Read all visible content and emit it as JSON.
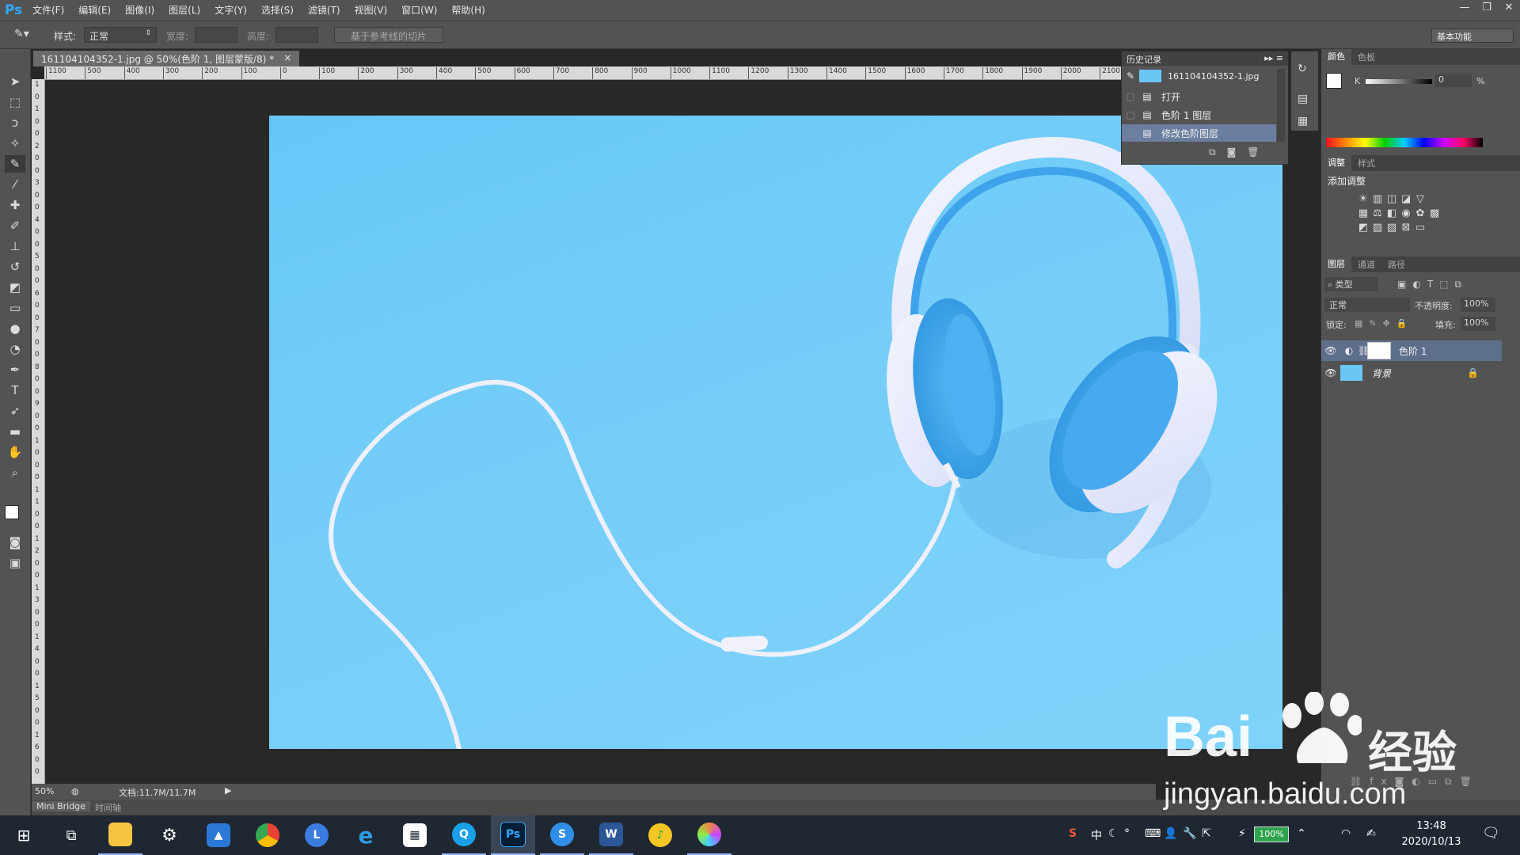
{
  "menubar": {
    "logo": "Ps",
    "items": [
      "文件(F)",
      "编辑(E)",
      "图像(I)",
      "图层(L)",
      "文字(Y)",
      "选择(S)",
      "滤镜(T)",
      "视图(V)",
      "窗口(W)",
      "帮助(H)"
    ],
    "window_controls": [
      "—",
      "❐",
      "✕"
    ]
  },
  "options": {
    "style_label": "样式:",
    "style_value": "正常",
    "width_label": "宽度:",
    "height_label": "高度:",
    "slice_button": "基于参考线的切片",
    "workspace": "基本功能"
  },
  "document": {
    "tab_title": "161104104352-1.jpg @ 50%(色阶 1, 图层蒙版/8) *",
    "close": "×",
    "ruler_top": [
      "1100",
      "500",
      "400",
      "300",
      "200",
      "100",
      "0",
      "100",
      "200",
      "300",
      "400",
      "500",
      "600",
      "700",
      "800",
      "900",
      "1000",
      "1100",
      "1200",
      "1300",
      "1400",
      "1500",
      "1600",
      "1700",
      "1800",
      "1900",
      "2000",
      "2100"
    ],
    "ruler_left": [
      "1",
      "0",
      "1",
      "0",
      "0",
      "2",
      "0",
      "0",
      "3",
      "0",
      "0",
      "4",
      "0",
      "0",
      "5",
      "0",
      "0",
      "6",
      "0",
      "0",
      "7",
      "0",
      "0",
      "8",
      "0",
      "0",
      "9",
      "0",
      "0",
      "1",
      "0",
      "0",
      "0",
      "1",
      "1",
      "0",
      "0",
      "1",
      "2",
      "0",
      "0",
      "1",
      "3",
      "0",
      "0",
      "1",
      "4",
      "0",
      "0",
      "1",
      "5",
      "0",
      "0",
      "1",
      "6",
      "0",
      "0"
    ]
  },
  "status": {
    "zoom": "50%",
    "doc_info": "文档:11.7M/11.7M",
    "tabs": [
      "Mini Bridge",
      "时间轴"
    ]
  },
  "history": {
    "title": "历史记录",
    "snapshot": "161104104352-1.jpg",
    "items": [
      "打开",
      "色阶 1 图层",
      "修改色阶图层"
    ]
  },
  "color_panel": {
    "tabs": [
      "颜色",
      "色板"
    ],
    "channel": "K",
    "value": "0",
    "unit": "%"
  },
  "adjustments": {
    "tabs": [
      "调整",
      "样式"
    ],
    "title": "添加调整"
  },
  "layers": {
    "tabs": [
      "图层",
      "通道",
      "路径"
    ],
    "filter": "类型",
    "blend_mode": "正常",
    "opacity_label": "不透明度:",
    "opacity": "100%",
    "lock_label": "锁定:",
    "fill_label": "填充:",
    "fill": "100%",
    "items": [
      {
        "name": "色阶 1"
      },
      {
        "name": "背景"
      }
    ]
  },
  "taskbar": {
    "tray_text": [
      "中",
      "⚬",
      "°"
    ],
    "battery": "100%",
    "time": "13:48",
    "date": "2020/10/13",
    "apps": [
      "file-explorer",
      "settings",
      "photos",
      "chrome",
      "l-app",
      "ie",
      "store",
      "q-app",
      "photoshop",
      "s-app",
      "word",
      "qq-music",
      "colorful"
    ]
  },
  "watermark": {
    "brand_left": "Bai",
    "brand_right": "经验",
    "url": "jingyan.baidu.com"
  },
  "colors": {
    "canvas_bg": "#70cbf8",
    "ps_blue": "#31a8ff",
    "panel": "#535353"
  }
}
